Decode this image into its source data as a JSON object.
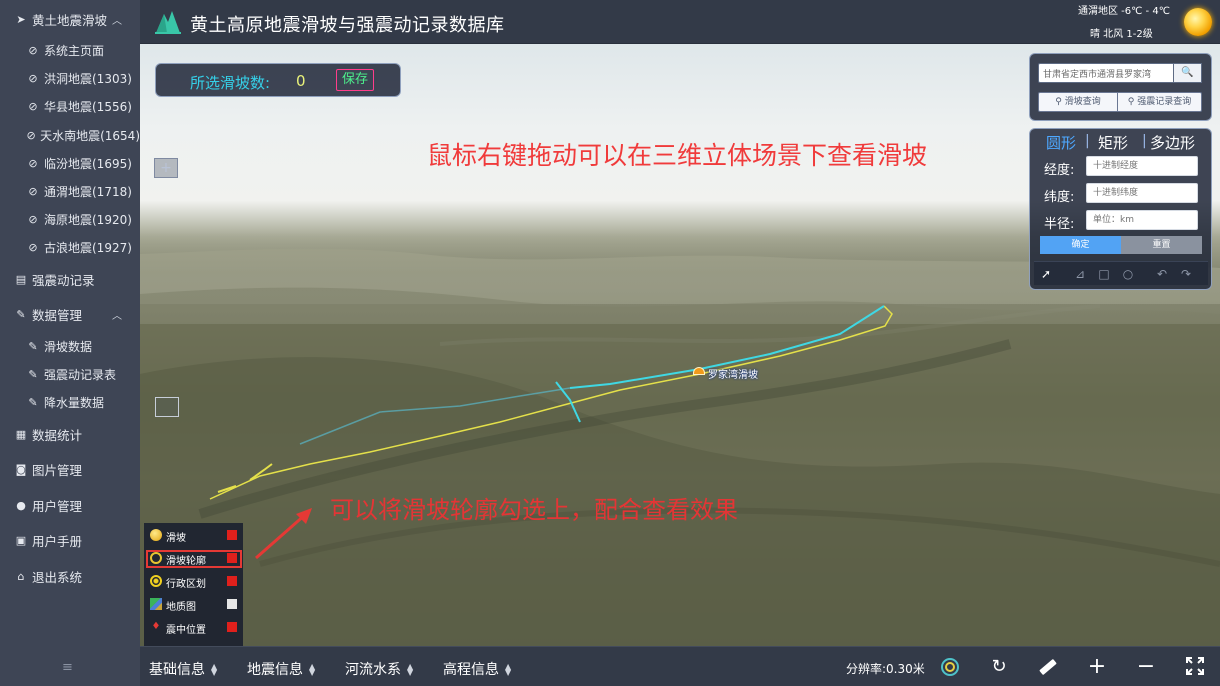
{
  "sidebar": {
    "items": [
      {
        "label": "黄土地震滑坡",
        "icon": "send-icon",
        "caret": "︿"
      },
      {
        "label": "系统主页面",
        "icon": "compass-icon"
      },
      {
        "label": "洪洞地震(1303)",
        "icon": "compass-icon"
      },
      {
        "label": "华县地震(1556)",
        "icon": "compass-icon"
      },
      {
        "label": "天水南地震(1654)",
        "icon": "compass-icon"
      },
      {
        "label": "临汾地震(1695)",
        "icon": "compass-icon"
      },
      {
        "label": "通渭地震(1718)",
        "icon": "compass-icon"
      },
      {
        "label": "海原地震(1920)",
        "icon": "compass-icon"
      },
      {
        "label": "古浪地震(1927)",
        "icon": "compass-icon"
      },
      {
        "label": "强震动记录",
        "icon": "clipboard-icon"
      },
      {
        "label": "数据管理",
        "icon": "edit-icon",
        "caret": "︿"
      },
      {
        "label": "滑坡数据",
        "icon": "edit-icon"
      },
      {
        "label": "强震动记录表",
        "icon": "edit-icon"
      },
      {
        "label": "降水量数据",
        "icon": "edit-icon"
      },
      {
        "label": "数据统计",
        "icon": "chart-icon"
      },
      {
        "label": "图片管理",
        "icon": "camera-icon"
      },
      {
        "label": "用户管理",
        "icon": "user-icon"
      },
      {
        "label": "用户手册",
        "icon": "book-icon"
      },
      {
        "label": "退出系统",
        "icon": "home-icon"
      }
    ],
    "menu_toggle": "≡"
  },
  "header": {
    "title": "黄土高原地震滑坡与强震动记录数据库",
    "weather_region": "通渭地区 -6℃ - 4℃",
    "weather_wind": "晴   北风 1-2级"
  },
  "map": {
    "selected_label": "所选滑坡数:",
    "selected_count": "0",
    "save_label": "保存",
    "zoom_in": "+",
    "hint_top": "鼠标右键拖动可以在三维立体场景下查看滑坡",
    "hint_bottom": "可以将滑坡轮廓勾选上，配合查看效果",
    "landslide_label": "罗家湾滑坡"
  },
  "search": {
    "value": "甘肃省定西市通渭县罗家湾",
    "go_icon": "🔍",
    "landslide_query": "滑坡查询",
    "quake_query": "强震记录查询"
  },
  "shape_query": {
    "tabs": [
      "圆形",
      "矩形",
      "多边形"
    ],
    "longitude_label": "经度:",
    "longitude_placeholder": "十进制经度",
    "latitude_label": "纬度:",
    "latitude_placeholder": "十进制纬度",
    "radius_label": "半径:",
    "radius_placeholder": "单位：km",
    "confirm": "确定",
    "reset": "重置"
  },
  "legend": {
    "items": [
      {
        "label": "滑坡",
        "checked_color": "#e0201c"
      },
      {
        "label": "滑坡轮廓",
        "checked_color": "#e0201c"
      },
      {
        "label": "行政区划",
        "checked_color": "#e0201c"
      },
      {
        "label": "地质图",
        "checked_color": "#e6e6e6"
      },
      {
        "label": "震中位置",
        "checked_color": "#e0201c"
      }
    ]
  },
  "bottombar": {
    "menus": [
      "基础信息",
      "地震信息",
      "河流水系",
      "高程信息"
    ],
    "resolution": "分辨率:0.30米"
  },
  "colors": {
    "accent_blue": "#4ea8ff",
    "hint_red": "#f03b3b",
    "count_cyan": "#35d0e8",
    "save_green": "#4df08c"
  }
}
